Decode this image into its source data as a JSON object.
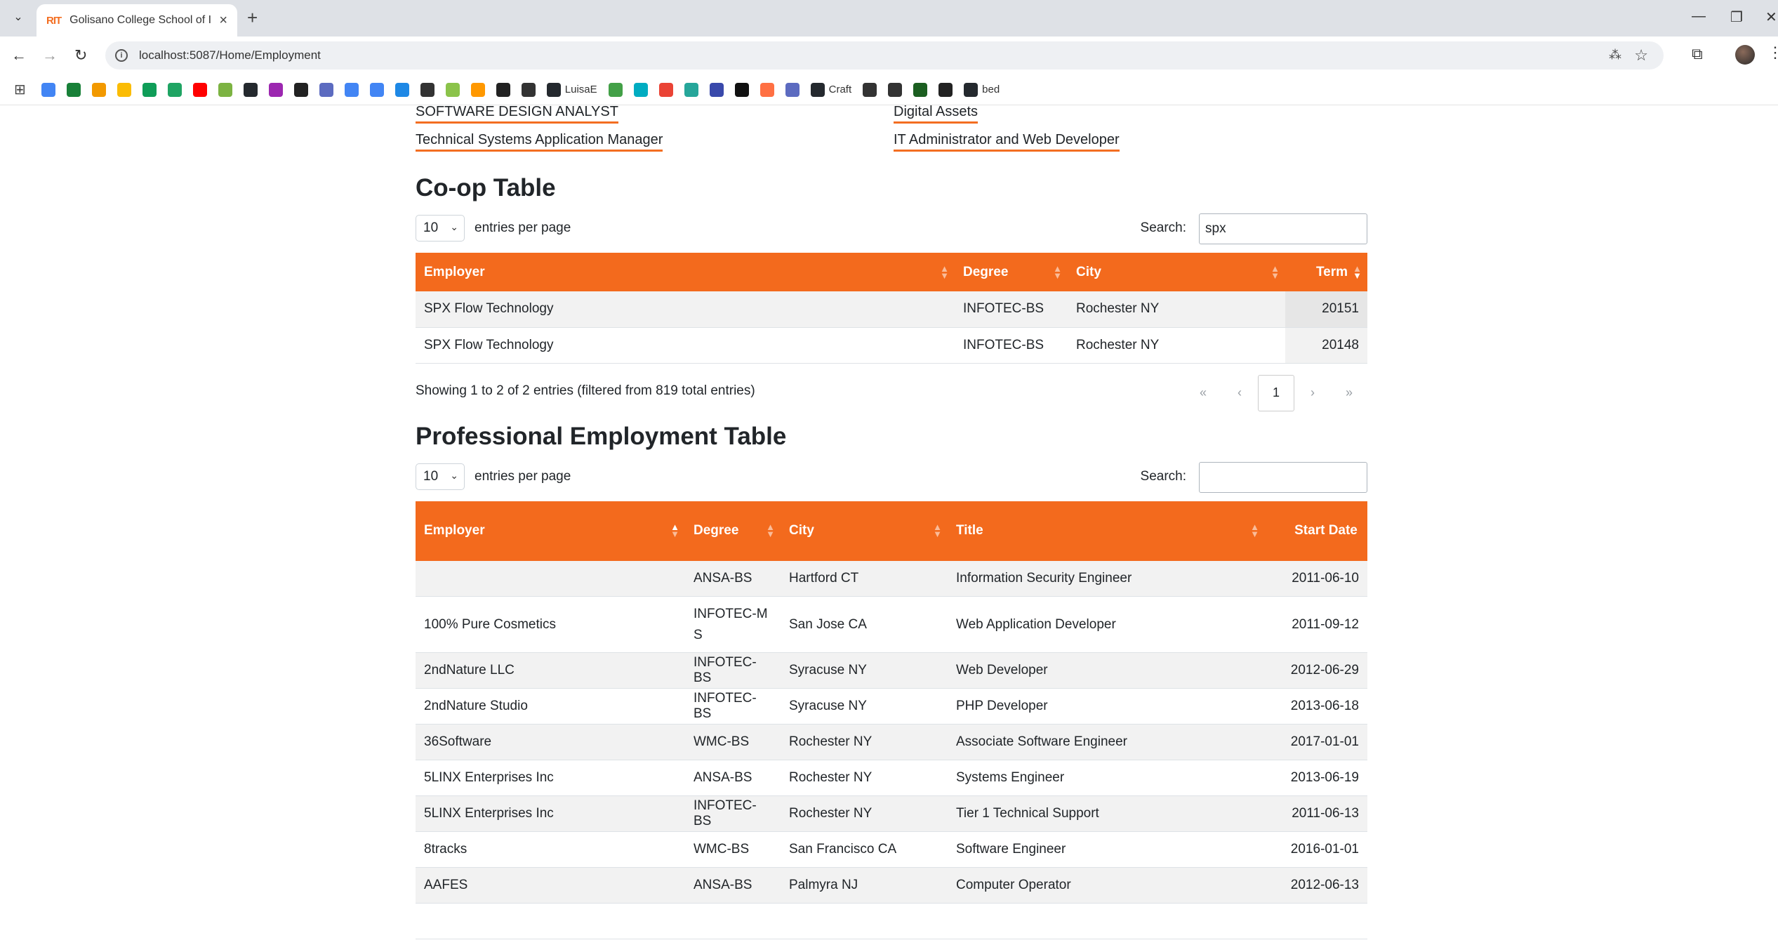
{
  "browser": {
    "tab_title": "Golisano College School of Info",
    "tab_favicon_text": "RIT",
    "url": "localhost:5087/Home/Employment",
    "bookmarks": [
      {
        "icon": "docs-icon",
        "color": "#4285f4",
        "label": ""
      },
      {
        "icon": "sheet-icon",
        "color": "#188038",
        "label": ""
      },
      {
        "icon": "orange-icon",
        "color": "#f29900",
        "label": ""
      },
      {
        "icon": "slides-icon",
        "color": "#fbbc04",
        "label": ""
      },
      {
        "icon": "green-plus-icon",
        "color": "#0f9d58",
        "label": ""
      },
      {
        "icon": "drive-icon",
        "color": "#1fa463",
        "label": ""
      },
      {
        "icon": "youtube-icon",
        "color": "#ff0000",
        "label": ""
      },
      {
        "icon": "android-icon",
        "color": "#7cb342",
        "label": ""
      },
      {
        "icon": "github-icon",
        "color": "#24292e",
        "label": ""
      },
      {
        "icon": "purple-icon",
        "color": "#9c27b0",
        "label": ""
      },
      {
        "icon": "openai-icon",
        "color": "#222222",
        "label": ""
      },
      {
        "icon": "blue-bird-icon",
        "color": "#5c6bc0",
        "label": ""
      },
      {
        "icon": "sparkle-icon",
        "color": "#4285f4",
        "label": ""
      },
      {
        "icon": "translate-icon",
        "color": "#4285f4",
        "label": ""
      },
      {
        "icon": "bot-icon",
        "color": "#1e88e5",
        "label": ""
      },
      {
        "icon": "slash-icon",
        "color": "#333333",
        "label": ""
      },
      {
        "icon": "lime-icon",
        "color": "#8bc34a",
        "label": ""
      },
      {
        "icon": "sun-icon",
        "color": "#ff9800",
        "label": ""
      },
      {
        "icon": "book-icon",
        "color": "#222222",
        "label": ""
      },
      {
        "icon": "db-icon",
        "color": "#333333",
        "label": ""
      },
      {
        "icon": "github-icon",
        "color": "#24292e",
        "label": "LuisaE"
      },
      {
        "icon": "image-icon",
        "color": "#43a047",
        "label": ""
      },
      {
        "icon": "refresh-icon",
        "color": "#00acc1",
        "label": ""
      },
      {
        "icon": "gmail-icon",
        "color": "#ea4335",
        "label": ""
      },
      {
        "icon": "teal-icon",
        "color": "#26a69a",
        "label": ""
      },
      {
        "icon": "x-tool-icon",
        "color": "#3949ab",
        "label": ""
      },
      {
        "icon": "m-icon",
        "color": "#111111",
        "label": ""
      },
      {
        "icon": "api-icon",
        "color": "#ff7043",
        "label": ""
      },
      {
        "icon": "shield-icon",
        "color": "#5c6bc0",
        "label": ""
      },
      {
        "icon": "github-icon",
        "color": "#24292e",
        "label": "Craft"
      },
      {
        "icon": "paw-icon",
        "color": "#333333",
        "label": ""
      },
      {
        "icon": "globe-icon",
        "color": "#333333",
        "label": ""
      },
      {
        "icon": "vuetify-icon",
        "color": "#1b5e20",
        "label": ""
      },
      {
        "icon": "hex-icon",
        "color": "#222222",
        "label": ""
      },
      {
        "icon": "github-icon",
        "color": "#24292e",
        "label": "bed"
      }
    ]
  },
  "links": {
    "left": [
      "SOFTWARE DESIGN ANALYST",
      "Technical Systems Application Manager"
    ],
    "right": [
      "Digital Assets",
      "IT Administrator and Web Developer"
    ]
  },
  "coop": {
    "title": "Co-op Table",
    "page_length": "10",
    "length_label": "entries per page",
    "search_label": "Search:",
    "search_value": "spx",
    "columns": [
      "Employer",
      "Degree",
      "City",
      "Term"
    ],
    "rows": [
      [
        "SPX Flow Technology",
        "INFOTEC-BS",
        "Rochester NY",
        "20151"
      ],
      [
        "SPX Flow Technology",
        "INFOTEC-BS",
        "Rochester NY",
        "20148"
      ]
    ],
    "info": "Showing 1 to 2 of 2 entries (filtered from 819 total entries)",
    "pager": {
      "first": "«",
      "prev": "‹",
      "current": "1",
      "next": "›",
      "last": "»"
    }
  },
  "professional": {
    "title": "Professional Employment Table",
    "page_length": "10",
    "length_label": "entries per page",
    "search_label": "Search:",
    "search_value": "",
    "columns": [
      "Employer",
      "Degree",
      "City",
      "Title",
      "Start Date"
    ],
    "rows": [
      [
        "",
        "ANSA-BS",
        "Hartford CT",
        "Information Security Engineer",
        "2011-06-10"
      ],
      [
        "100% Pure Cosmetics",
        "INFOTEC-MS",
        "San Jose CA",
        "Web Application Developer",
        "2011-09-12"
      ],
      [
        "2ndNature LLC",
        "INFOTEC-BS",
        "Syracuse NY",
        "Web Developer",
        "2012-06-29"
      ],
      [
        "2ndNature Studio",
        "INFOTEC-BS",
        "Syracuse NY",
        "PHP Developer",
        "2013-06-18"
      ],
      [
        "36Software",
        "WMC-BS",
        "Rochester NY",
        "Associate Software Engineer",
        "2017-01-01"
      ],
      [
        "5LINX Enterprises Inc",
        "ANSA-BS",
        "Rochester NY",
        "Systems Engineer",
        "2013-06-19"
      ],
      [
        "5LINX Enterprises Inc",
        "INFOTEC-BS",
        "Rochester NY",
        "Tier 1 Technical Support",
        "2011-06-13"
      ],
      [
        "8tracks",
        "WMC-BS",
        "San Francisco CA",
        "Software Engineer",
        "2016-01-01"
      ],
      [
        "AAFES",
        "ANSA-BS",
        "Palmyra NJ",
        "Computer Operator",
        "2012-06-13"
      ],
      [
        "",
        "",
        "",
        "",
        ""
      ]
    ]
  },
  "colors": {
    "accent": "#f36a1d",
    "link_underline": "#f36e21"
  }
}
